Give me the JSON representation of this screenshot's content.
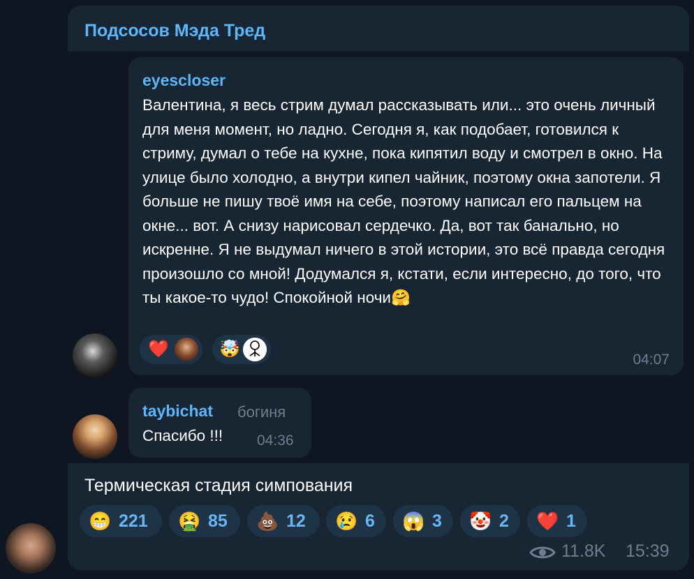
{
  "thread": {
    "title": "Подсосов Мэда Тред"
  },
  "messages": [
    {
      "author": "eyescloser",
      "text": "Валентина, я весь стрим думал рассказывать или... это очень личный для меня момент, но ладно. Сегодня я, как подобает, готовился к стриму, думал о тебе на кухне, пока кипятил воду и смотрел в окно. На улице было холодно, а внутри кипел чайник, поэтому окна запотели. Я больше не пишу твоё имя на себе, поэтому написал его пальцем на окне... вот. А снизу нарисовал сердечко. Да, вот так банально, но искренне. Я не выдумал ничего в этой истории, это всё правда сегодня произошло со мной! Додумался я, кстати, если интересно, до того, что ты какое-то чудо! Спокойной ночи🤗",
      "time": "04:07",
      "reactions": [
        "❤️",
        "🤯"
      ]
    },
    {
      "author": "taybichat",
      "rank": "богиня",
      "text": "Спасибо !!!",
      "time": "04:36"
    }
  ],
  "post": {
    "text": "Термическая стадия симпования",
    "reactions": [
      {
        "emoji": "😁",
        "count": "221"
      },
      {
        "emoji": "🤮",
        "count": "85"
      },
      {
        "emoji": "💩",
        "count": "12"
      },
      {
        "emoji": "😢",
        "count": "6"
      },
      {
        "emoji": "😱",
        "count": "3"
      },
      {
        "emoji": "🤡",
        "count": "2"
      },
      {
        "emoji": "❤️",
        "count": "1"
      }
    ],
    "views": "11.8K",
    "time": "15:39"
  },
  "colors": {
    "background": "#0e1621",
    "bubble": "#182533",
    "accent": "#5eb5f7",
    "muted": "#6d7f8f",
    "reaction_bg": "#1f3346"
  },
  "icons": {
    "views": "eye-icon"
  }
}
